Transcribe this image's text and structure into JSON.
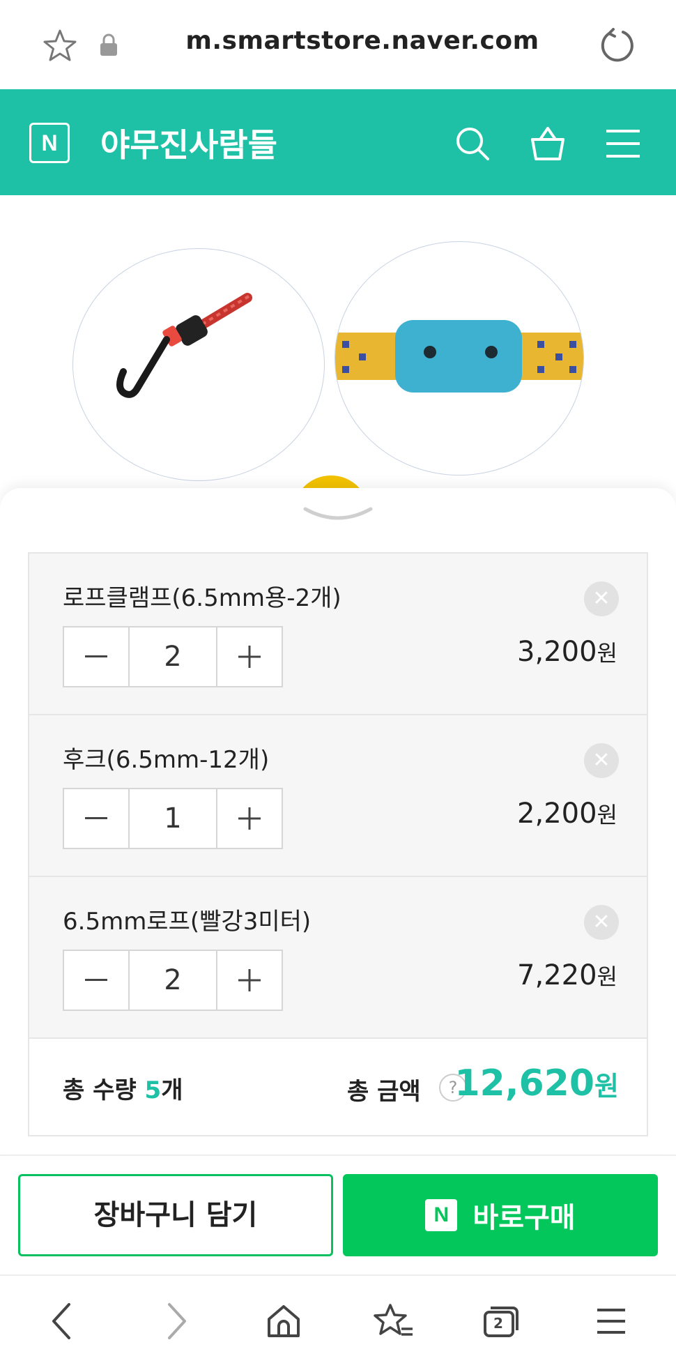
{
  "browser": {
    "url": "m.smartstore.naver.com",
    "tab_count": "2"
  },
  "store": {
    "logo": "N",
    "name": "야무진사람들"
  },
  "options": [
    {
      "name": "로프클램프(6.5mm용-2개)",
      "quantity": "2",
      "price": "3,200",
      "currency": "원"
    },
    {
      "name": "후크(6.5mm-12개)",
      "quantity": "1",
      "price": "2,200",
      "currency": "원"
    },
    {
      "name": "6.5mm로프(빨강3미터)",
      "quantity": "2",
      "price": "7,220",
      "currency": "원"
    }
  ],
  "totals": {
    "qty_label": "총 수량",
    "qty_value": "5",
    "qty_unit": "개",
    "amount_label": "총 금액",
    "help": "?",
    "amount_value": "12,620",
    "currency": "원"
  },
  "buttons": {
    "cart": "장바구니 담기",
    "buy_badge": "N",
    "buy": "바로구매"
  },
  "colors": {
    "brand": "#1fc1a6",
    "buy_green": "#03c75a"
  },
  "icons": {
    "header": [
      "search-icon",
      "shopping-bag-icon",
      "menu-icon"
    ],
    "browser_nav": [
      "back-icon",
      "forward-icon",
      "home-icon",
      "bookmarks-icon",
      "tabs-icon",
      "menu-icon"
    ]
  }
}
